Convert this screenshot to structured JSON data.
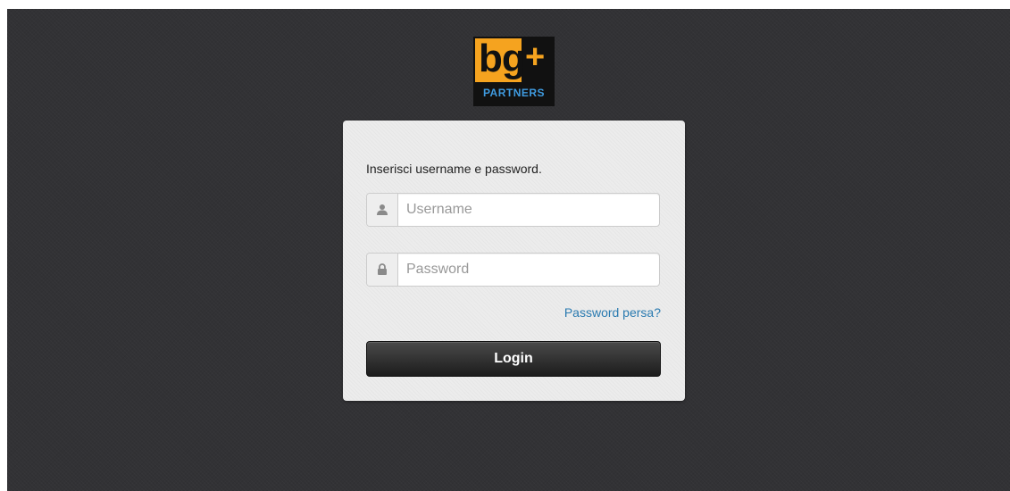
{
  "logo": {
    "main_text": "bg",
    "plus_text": "+",
    "sub_text": "PARTNERS",
    "colors": {
      "orange": "#f5a31f",
      "dark": "#111111",
      "blue": "#3f9be0"
    }
  },
  "login": {
    "prompt": "Inserisci username e password.",
    "username": {
      "placeholder": "Username",
      "value": "",
      "icon": "user-icon"
    },
    "password": {
      "placeholder": "Password",
      "value": "",
      "icon": "lock-icon"
    },
    "lost_password_label": "Password persa?",
    "login_label": "Login"
  },
  "colors": {
    "background": "#323235",
    "card": "#ececec",
    "link": "#2a7ab0",
    "button": "#2b2b2b"
  }
}
